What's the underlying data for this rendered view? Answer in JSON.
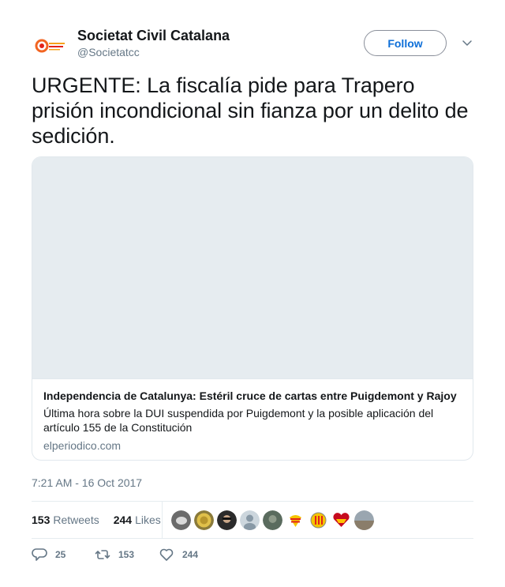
{
  "tweet": {
    "author": {
      "display_name": "Societat Civil Catalana",
      "handle": "@Societatcc",
      "avatar_icon": "societat-civil-catalana-logo"
    },
    "follow_label": "Follow",
    "text": "URGENTE: La fiscalía pide para Trapero prisión incondicional sin fianza por un delito de sedición.",
    "card": {
      "title": "Independencia de Catalunya: Estéril cruce de cartas entre Puigdemont y Rajoy",
      "description": "Última hora sobre la DUI suspendida por Puigdemont y la posible aplicación del artículo 155 de la Constitución",
      "domain": "elperiodico.com"
    },
    "timestamp": "7:21 AM - 16 Oct 2017",
    "stats": {
      "retweets_count": "153",
      "retweets_label": "Retweets",
      "likes_count": "244",
      "likes_label": "Likes"
    },
    "actions": {
      "reply_count": "25",
      "retweet_count": "153",
      "like_count": "244"
    }
  },
  "colors": {
    "accent": "#1da1f2",
    "follow_text": "#0e6fd8",
    "secondary_text": "#657786",
    "border": "#e1e8ed"
  }
}
